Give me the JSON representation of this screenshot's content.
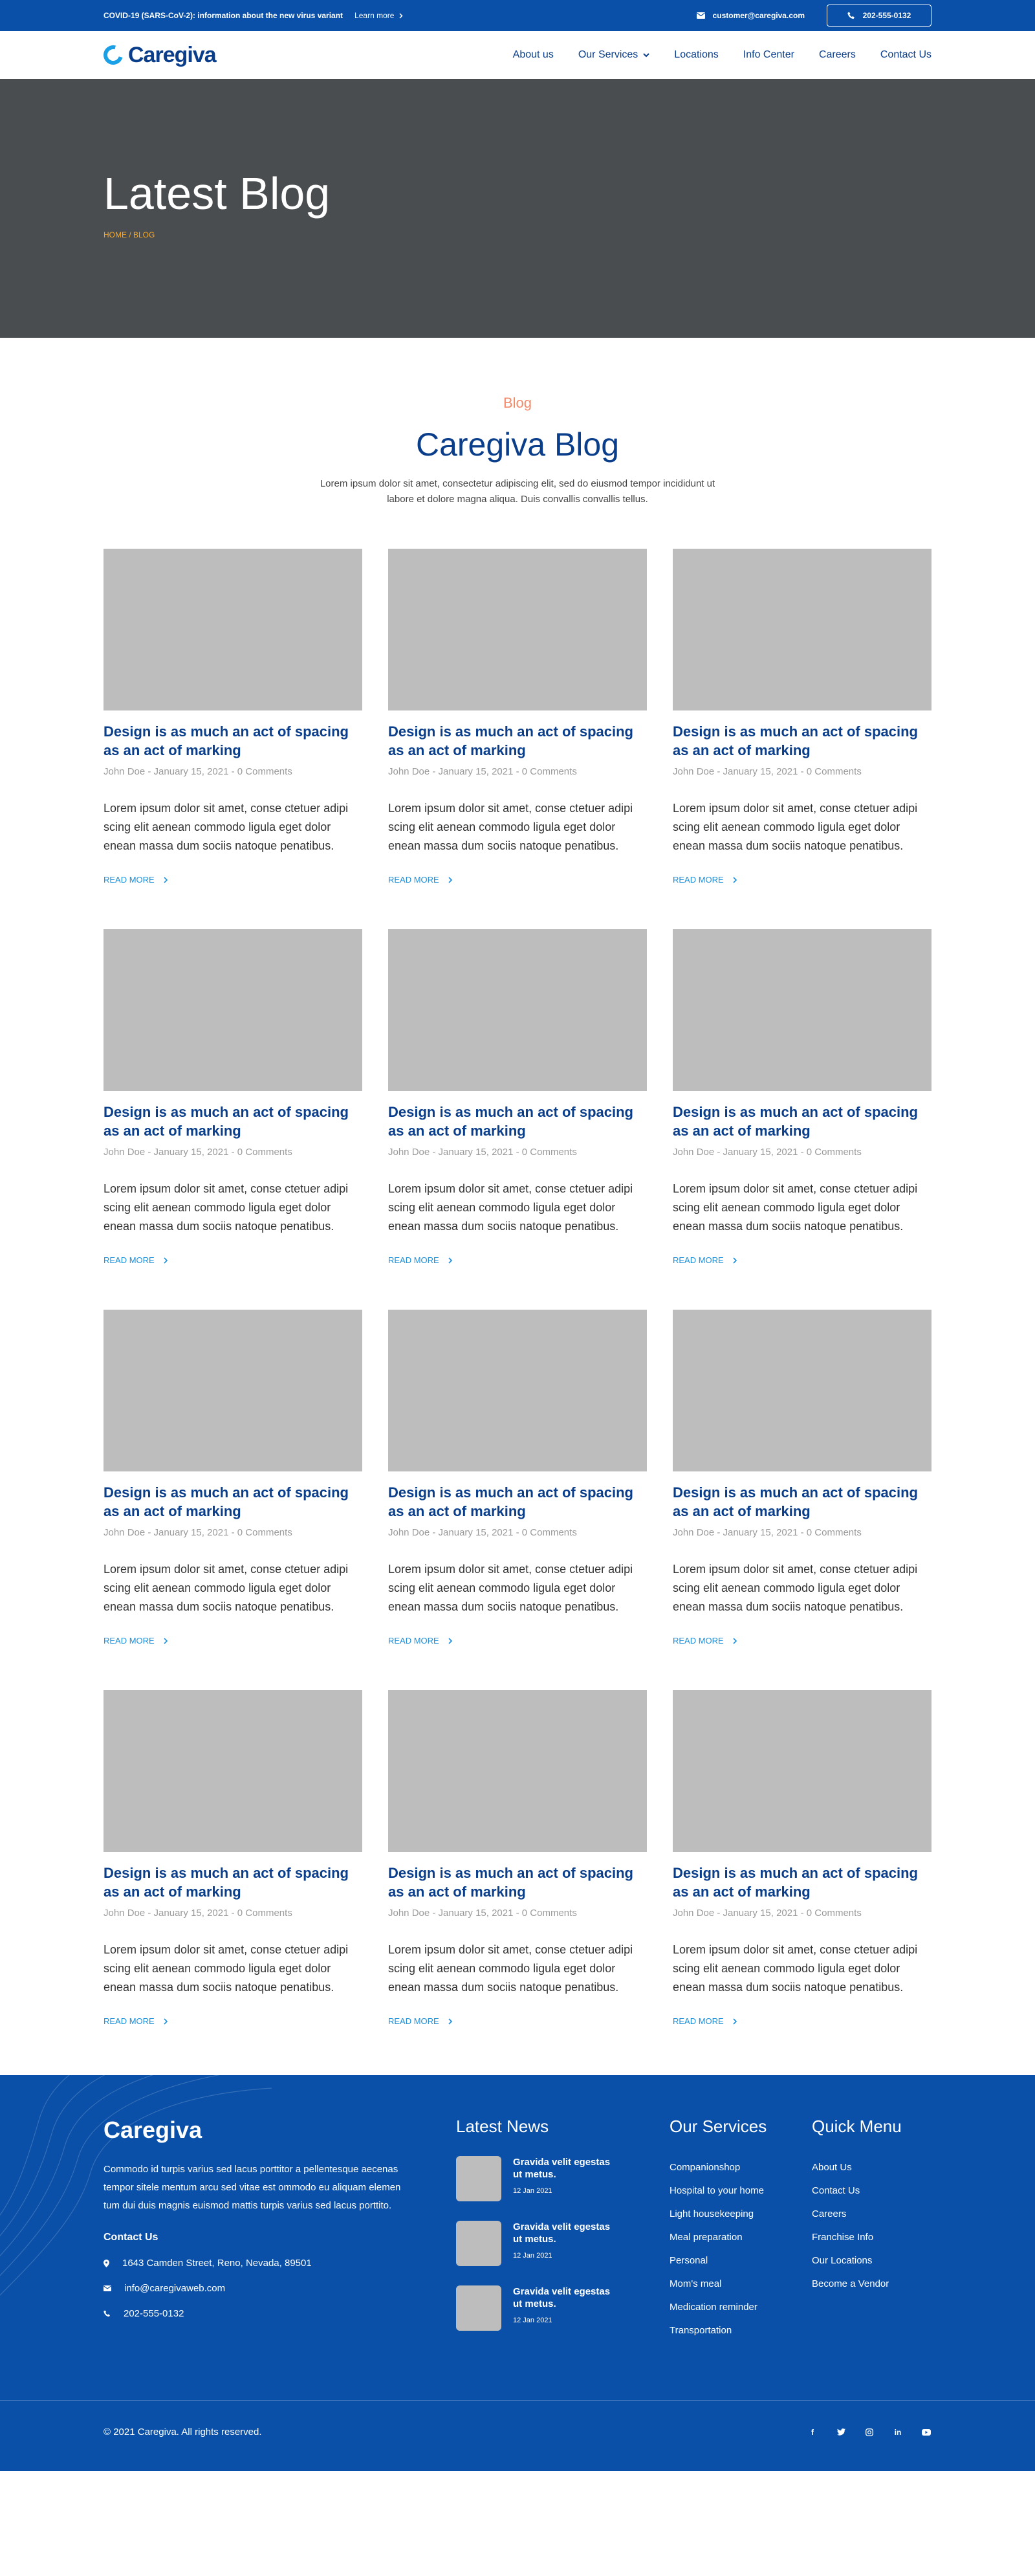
{
  "topbar": {
    "notice": "COVID-19 (SARS-CoV-2): information about the new virus variant",
    "learn_more": "Learn more",
    "email": "customer@caregiva.com",
    "phone": "202-555-0132"
  },
  "header": {
    "logo": "Caregiva",
    "nav": [
      "About us",
      "Our Services",
      "Locations",
      "Info Center",
      "Careers",
      "Contact Us"
    ]
  },
  "hero": {
    "title": "Latest Blog",
    "breadcrumb": "HOME / BLOG"
  },
  "intro": {
    "kicker": "Blog",
    "title": "Caregiva Blog",
    "text": "Lorem ipsum dolor sit amet, consectetur adipiscing elit, sed do eiusmod tempor incididunt ut labore et dolore magna aliqua. Duis convallis convallis tellus."
  },
  "posts": {
    "title": "Design is as much an act of spacing as an act of marking",
    "meta": "John Doe  -  January 15, 2021  -  0 Comments",
    "excerpt": "Lorem ipsum dolor sit amet, conse ctetuer adipi scing elit aenean commodo ligula eget dolor enean massa dum sociis natoque penatibus.",
    "read_more": "READ MORE",
    "count": 12
  },
  "footer": {
    "brand": "Caregiva",
    "description": "Commodo id turpis varius sed lacus porttitor a pellentesque aecenas tempor sitele mentum arcu sed vitae est ommodo eu aliquam elemen tum dui duis magnis euismod mattis turpis varius sed lacus porttito.",
    "contact_title": "Contact Us",
    "address": "1643  Camden Street, Reno, Nevada, 89501",
    "email": "info@caregivaweb.com",
    "phone": "202-555-0132",
    "news_title": "Latest News",
    "news": [
      {
        "title": "Gravida velit egestas ut metus.",
        "date": "12 Jan 2021"
      },
      {
        "title": "Gravida velit egestas ut metus.",
        "date": "12 Jan 2021"
      },
      {
        "title": "Gravida velit egestas ut metus.",
        "date": "12 Jan 2021"
      }
    ],
    "services_title": "Our Services",
    "services": [
      "Companionshop",
      "Hospital to your home",
      "Light housekeeping",
      "Meal preparation",
      "Personal",
      "Mom's meal",
      "Medication reminder",
      "Transportation"
    ],
    "menu_title": "Quick Menu",
    "menu": [
      "About Us",
      "Contact Us",
      "Careers",
      "Franchise Info",
      "Our Locations",
      "Become a Vendor"
    ],
    "copyright": "© 2021 Caregiva. All rights reserved.",
    "social": [
      "facebook-icon",
      "twitter-icon",
      "instagram-icon",
      "linkedin-icon",
      "youtube-icon"
    ]
  }
}
